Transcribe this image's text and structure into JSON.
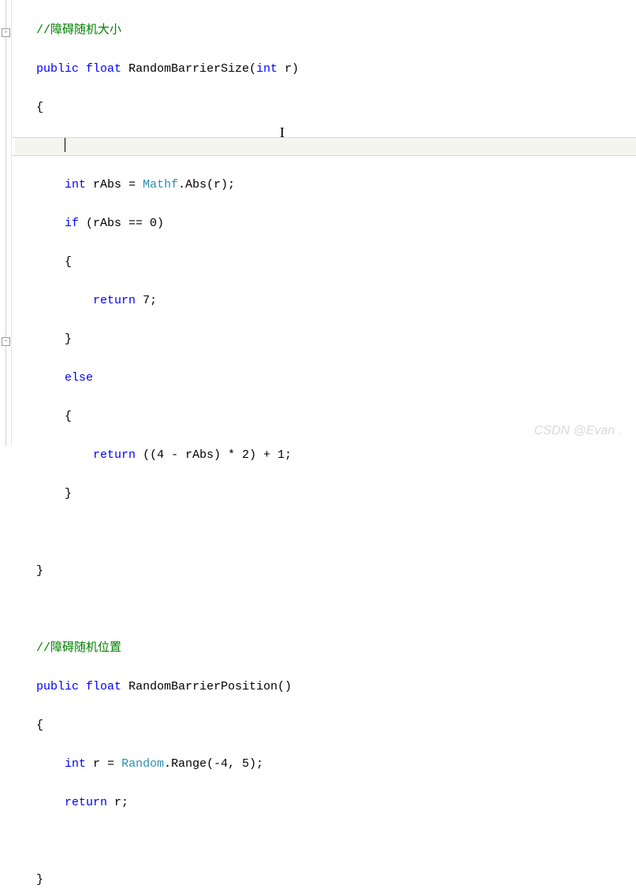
{
  "code": {
    "comment1": "//障碍随机大小",
    "func1": {
      "pub": "public",
      "flt": "float",
      "name": "RandomBarrierSize",
      "paramType": "int",
      "paramName": "r",
      "openBrace": "{",
      "intKw": "int",
      "rAbs": "rAbs",
      "eq": "=",
      "mathf": "Mathf",
      "absCall": ".Abs(r);",
      "ifKw": "if",
      "ifCond": "(rAbs == 0)",
      "ifOpen": "{",
      "retKw": "return",
      "retVal1": "7;",
      "ifClose": "}",
      "elseKw": "else",
      "elseOpen": "{",
      "retVal2": "((4 - rAbs) * 2) + 1;",
      "elseClose": "}",
      "closeBrace": "}"
    },
    "comment2": "//障碍随机位置",
    "func2": {
      "pub": "public",
      "flt": "float",
      "name": "RandomBarrierPosition",
      "params": "()",
      "openBrace": "{",
      "intKw": "int",
      "rVar": "r",
      "eq": "=",
      "random": "Random",
      "rangeCall": ".Range(-4, 5);",
      "retKw": "return",
      "retVal": "r;",
      "closeBrace": "}"
    }
  },
  "watermark": "CSDN @Evan ."
}
